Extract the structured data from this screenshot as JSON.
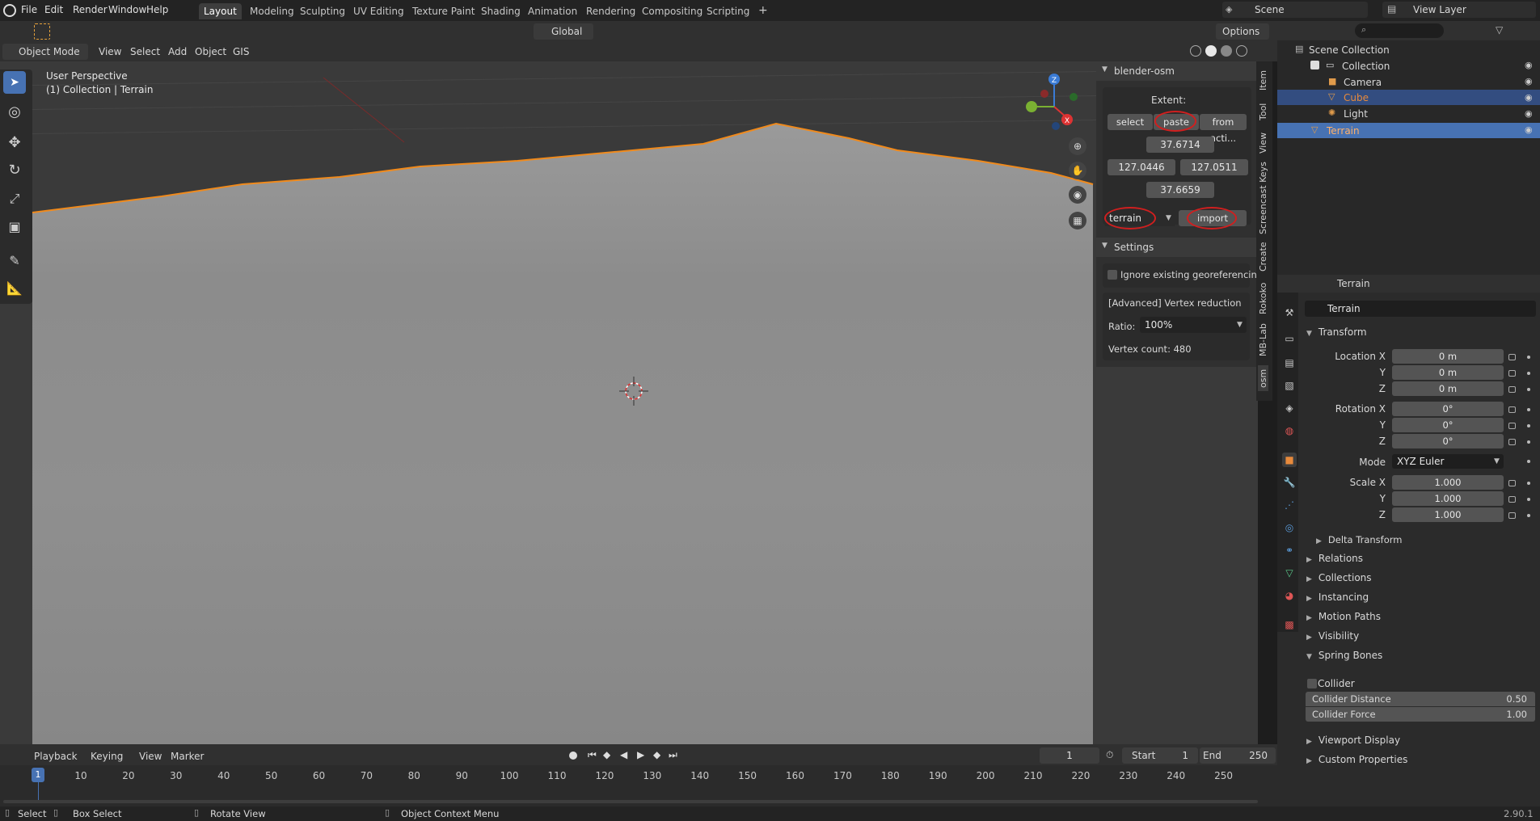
{
  "topbar": {
    "menus": [
      "File",
      "Edit",
      "Render",
      "Window",
      "Help"
    ],
    "workspaces": [
      "Layout",
      "Modeling",
      "Sculpting",
      "UV Editing",
      "Texture Paint",
      "Shading",
      "Animation",
      "Rendering",
      "Compositing",
      "Scripting"
    ],
    "add_tab": "+",
    "scene": "Scene",
    "view_layer": "View Layer"
  },
  "viewport_header": {
    "mode": "Object Mode",
    "menus": [
      "View",
      "Select",
      "Add",
      "Object",
      "GIS"
    ],
    "transform": "Global",
    "options": "Options"
  },
  "viewport": {
    "perspective": "User Perspective",
    "collection": "(1) Collection | Terrain"
  },
  "gizmo": {
    "x": "X",
    "y": "Y",
    "z": "Z"
  },
  "npanel": {
    "title": "blender-osm",
    "extent_label": "Extent:",
    "btn_select": "select",
    "btn_paste": "paste",
    "btn_from": "from acti...",
    "lat_max": "37.6714",
    "lon_min": "127.0446",
    "lon_max": "127.0511",
    "lat_min": "37.6659",
    "source": "terrain",
    "btn_import": "import",
    "settings_title": "Settings",
    "ignore_geo": "Ignore existing georeferencing",
    "vertex_reduction": "[Advanced] Vertex reduction",
    "ratio_label": "Ratio:",
    "ratio_value": "100%",
    "vertex_count": "Vertex count: 480"
  },
  "vtabs": [
    "Item",
    "Tool",
    "View",
    "Screencast Keys",
    "Create",
    "Rokoko",
    "MB-Lab",
    "osm"
  ],
  "outliner": {
    "search_placeholder": "",
    "root": "Scene Collection",
    "collection": "Collection",
    "items": [
      "Camera",
      "Cube",
      "Light"
    ],
    "terrain": "Terrain"
  },
  "properties": {
    "object_name": "Terrain",
    "data_name": "Terrain",
    "transform": "Transform",
    "location_label": "Location X",
    "y": "Y",
    "z": "Z",
    "loc": [
      "0 m",
      "0 m",
      "0 m"
    ],
    "rotation_label": "Rotation X",
    "rot": [
      "0°",
      "0°",
      "0°"
    ],
    "mode_label": "Mode",
    "mode_value": "XYZ Euler",
    "scale_label": "Scale X",
    "scale": [
      "1.000",
      "1.000",
      "1.000"
    ],
    "delta": "Delta Transform",
    "sections": [
      "Relations",
      "Collections",
      "Instancing",
      "Motion Paths",
      "Visibility"
    ],
    "spring_bones": "Spring Bones",
    "collider": "Collider",
    "collider_distance_label": "Collider Distance",
    "collider_distance": "0.50",
    "collider_force_label": "Collider Force",
    "collider_force": "1.00",
    "viewport_display": "Viewport Display",
    "custom_props": "Custom Properties"
  },
  "timeline": {
    "menus": [
      "Playback",
      "Keying",
      "View",
      "Marker"
    ],
    "current": "1",
    "start_label": "Start",
    "start": "1",
    "end_label": "End",
    "end": "250",
    "ticks": [
      "10",
      "20",
      "30",
      "40",
      "50",
      "60",
      "70",
      "80",
      "90",
      "100",
      "110",
      "120",
      "130",
      "140",
      "150",
      "160",
      "170",
      "180",
      "190",
      "200",
      "210",
      "220",
      "230",
      "240",
      "250"
    ],
    "frame_marker": "1"
  },
  "statusbar": {
    "select": "Select",
    "box_select": "Box Select",
    "rotate": "Rotate View",
    "context": "Object Context Menu",
    "version": "2.90.1"
  }
}
